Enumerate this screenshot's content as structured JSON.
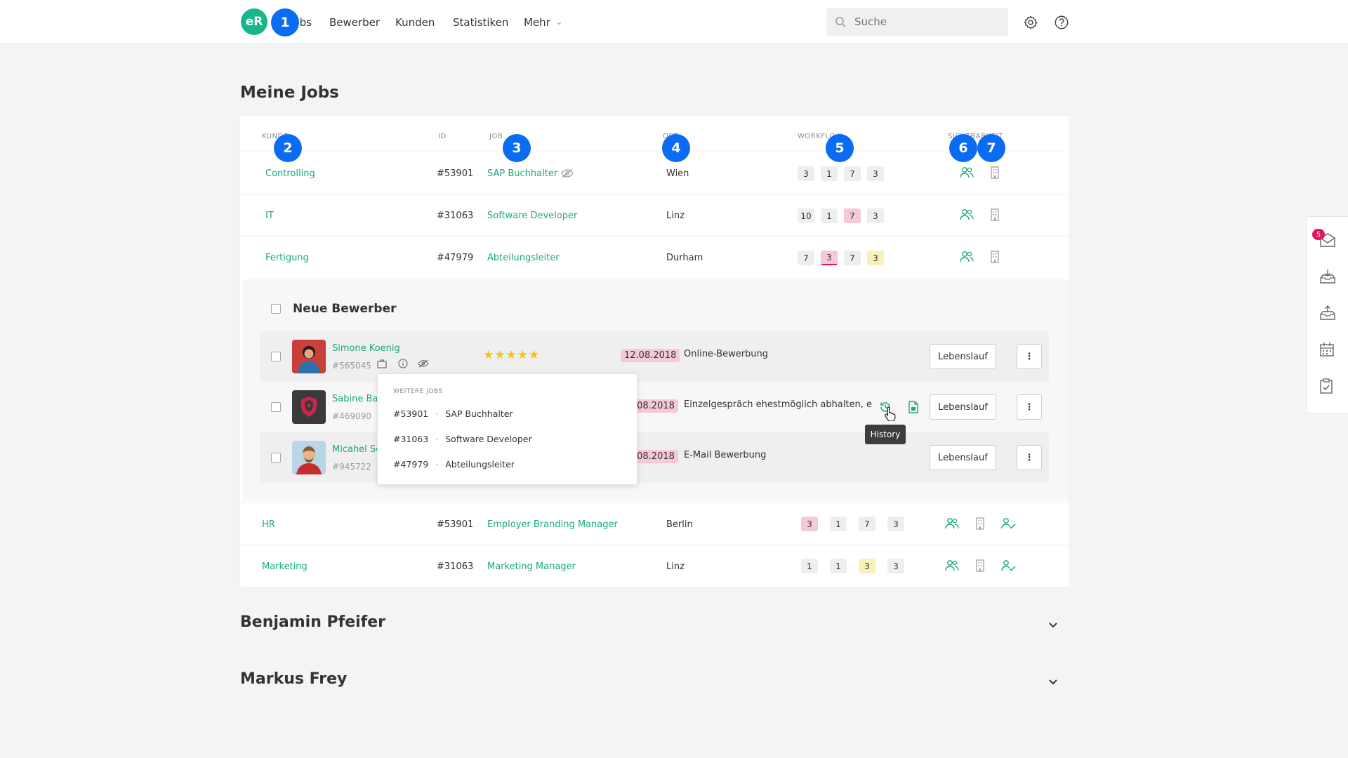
{
  "app": {
    "logo_text": "eR",
    "brand_color": "#19b58a",
    "accent_color": "#0a6cf2"
  },
  "nav": {
    "items": [
      "Jobs",
      "Bewerber",
      "Kunden",
      "Statistiken",
      "Mehr"
    ]
  },
  "search": {
    "placeholder": "Suche"
  },
  "markers": [
    "1",
    "2",
    "3",
    "4",
    "5",
    "6",
    "7"
  ],
  "page_title": "Meine Jobs",
  "columns": {
    "kunde": "KUNDE",
    "id": "ID",
    "job": "JOB",
    "ort": "ORT",
    "workflow": "WORKFLOW",
    "sichtbarkeit": "SICHTBARKEIT"
  },
  "jobs": [
    {
      "kunde": "Controlling",
      "id": "#53901",
      "job": "SAP Buchhalter",
      "ort": "Wien",
      "wf": [
        "3",
        "1",
        "7",
        "3"
      ]
    },
    {
      "kunde": "IT",
      "id": "#31063",
      "job": "Software Developer",
      "ort": "Linz",
      "wf": [
        "10",
        "1",
        "7",
        "3"
      ]
    },
    {
      "kunde": "Fertigung",
      "id": "#47979",
      "job": "Abteilungsleiter",
      "ort": "Durham",
      "wf": [
        "7",
        "3",
        "7",
        "3"
      ]
    },
    {
      "kunde": "HR",
      "id": "#53901",
      "job": "Employer Branding Manager",
      "ort": "Berlin",
      "wf": [
        "3",
        "1",
        "7",
        "3"
      ]
    },
    {
      "kunde": "Marketing",
      "id": "#31063",
      "job": "Marketing Manager",
      "ort": "Linz",
      "wf": [
        "1",
        "1",
        "3",
        "3"
      ]
    }
  ],
  "panel": {
    "title": "Neue Bewerber",
    "applicants": [
      {
        "name": "Simone Koenig",
        "id": "#565045",
        "date": "12.08.2018",
        "desc": "Online-Bewerbung",
        "rating": 5,
        "stars": "★★★★★",
        "button": "Lebenslauf",
        "more": "⋮"
      },
      {
        "name": "Sabine Bay",
        "id": "#469090",
        "date": ".08.2018",
        "desc": "Einzelgespräch ehestmöglich abhalten, even",
        "button": "Lebenslauf",
        "more": "⋮"
      },
      {
        "name": "Micahel Sch",
        "id": "#945722",
        "date": ".08.2018",
        "desc": "E-Mail Bewerbung",
        "button": "Lebenslauf",
        "more": "⋮"
      }
    ]
  },
  "popover": {
    "heading": "WEITERE JOBS",
    "items": [
      {
        "id": "#53901",
        "job": "SAP Buchhalter"
      },
      {
        "id": "#31063",
        "job": "Software Developer"
      },
      {
        "id": "#47979",
        "job": "Abteilungsleiter"
      }
    ],
    "sep": "·"
  },
  "tooltip": "History",
  "sections": [
    "Benjamin Pfeifer",
    "Markus Frey"
  ],
  "sidepanel": {
    "notification_count": "5"
  }
}
